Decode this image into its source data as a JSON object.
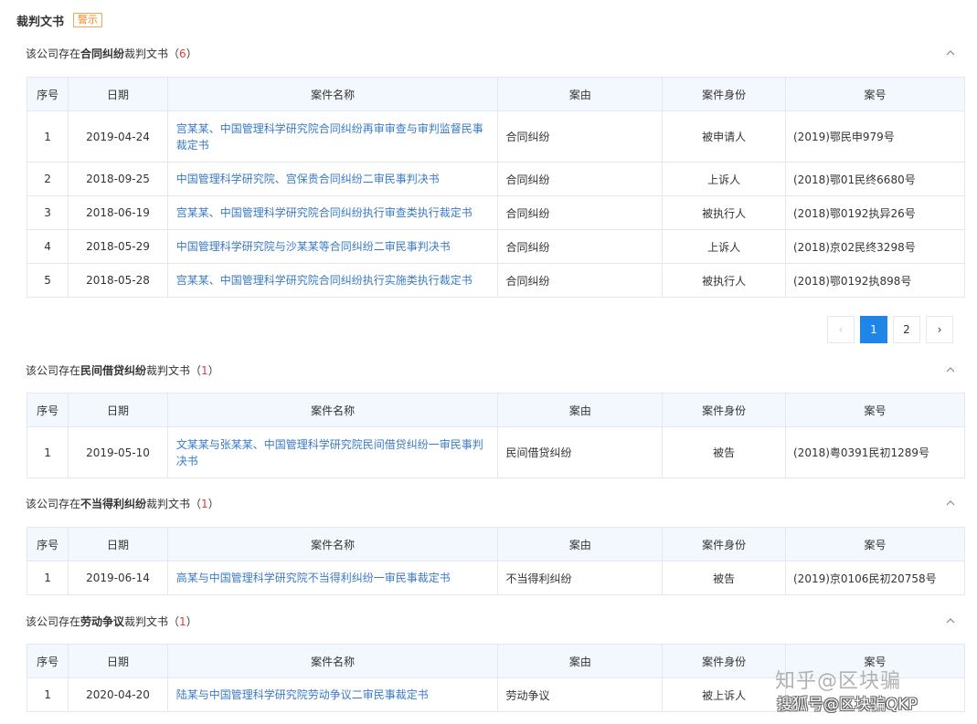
{
  "header": {
    "title": "裁判文书",
    "badge": "警示"
  },
  "columns": [
    "序号",
    "日期",
    "案件名称",
    "案由",
    "案件身份",
    "案号"
  ],
  "sections": [
    {
      "prefix": "该公司存在",
      "topic": "合同纠纷",
      "suffix": "裁判文书（",
      "count": "6",
      "close": "）",
      "rows": [
        {
          "no": "1",
          "date": "2019-04-24",
          "name": "宫某某、中国管理科学研究院合同纠纷再审审查与审判监督民事裁定书",
          "reason": "合同纠纷",
          "role": "被申请人",
          "case_no": "(2019)鄂民申979号"
        },
        {
          "no": "2",
          "date": "2018-09-25",
          "name": "中国管理科学研究院、宫保贵合同纠纷二审民事判决书",
          "reason": "合同纠纷",
          "role": "上诉人",
          "case_no": "(2018)鄂01民终6680号"
        },
        {
          "no": "3",
          "date": "2018-06-19",
          "name": "宫某某、中国管理科学研究院合同纠纷执行审查类执行裁定书",
          "reason": "合同纠纷",
          "role": "被执行人",
          "case_no": "(2018)鄂0192执异26号"
        },
        {
          "no": "4",
          "date": "2018-05-29",
          "name": "中国管理科学研究院与沙某某等合同纠纷二审民事判决书",
          "reason": "合同纠纷",
          "role": "上诉人",
          "case_no": "(2018)京02民终3298号"
        },
        {
          "no": "5",
          "date": "2018-05-28",
          "name": "宫某某、中国管理科学研究院合同纠纷执行实施类执行裁定书",
          "reason": "合同纠纷",
          "role": "被执行人",
          "case_no": "(2018)鄂0192执898号"
        }
      ]
    },
    {
      "prefix": "该公司存在",
      "topic": "民间借贷纠纷",
      "suffix": "裁判文书（",
      "count": "1",
      "close": "）",
      "rows": [
        {
          "no": "1",
          "date": "2019-05-10",
          "name": "文某某与张某某、中国管理科学研究院民间借贷纠纷一审民事判决书",
          "reason": "民间借贷纠纷",
          "role": "被告",
          "case_no": "(2018)粤0391民初1289号"
        }
      ]
    },
    {
      "prefix": "该公司存在",
      "topic": "不当得利纠纷",
      "suffix": "裁判文书（",
      "count": "1",
      "close": "）",
      "rows": [
        {
          "no": "1",
          "date": "2019-06-14",
          "name": "高某与中国管理科学研究院不当得利纠纷一审民事裁定书",
          "reason": "不当得利纠纷",
          "role": "被告",
          "case_no": "(2019)京0106民初20758号"
        }
      ]
    },
    {
      "prefix": "该公司存在",
      "topic": "劳动争议",
      "suffix": "裁判文书（",
      "count": "1",
      "close": "）",
      "rows": [
        {
          "no": "1",
          "date": "2020-04-20",
          "name": "陆某与中国管理科学研究院劳动争议二审民事裁定书",
          "reason": "劳动争议",
          "role": "被上诉人",
          "case_no": ""
        }
      ]
    }
  ],
  "pagination": {
    "prev": "‹",
    "pages": [
      "1",
      "2"
    ],
    "current": "1",
    "next": "›"
  },
  "watermark": {
    "line1": "知乎@区块骗",
    "line2": "搜狐号@区块骗QKP"
  },
  "colors": {
    "link": "#3a7ac4",
    "count": "#e4393c",
    "badge": "#f08a24",
    "header_bg": "#f2f8fd",
    "active_page": "#1f85e6"
  },
  "icons": {
    "collapse": "chevron-up-icon",
    "prev": "chevron-left-icon",
    "next": "chevron-right-icon"
  }
}
